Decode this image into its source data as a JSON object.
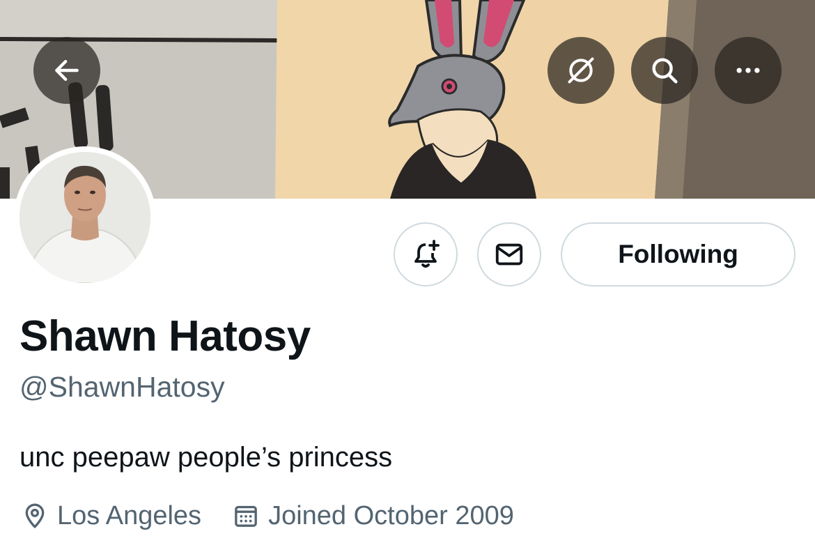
{
  "profile": {
    "display_name": "Shawn Hatosy",
    "handle": "@ShawnHatosy",
    "bio": "unc peepaw people’s princess",
    "location": "Los Angeles",
    "joined": "Joined October 2009"
  },
  "actions": {
    "following_label": "Following"
  },
  "icons": {
    "back": "arrow-left-icon",
    "grok": "grok-icon",
    "search": "search-icon",
    "more": "more-horizontal-icon",
    "notify": "bell-plus-icon",
    "message": "envelope-icon",
    "location": "location-pin-icon",
    "calendar": "calendar-icon"
  },
  "colors": {
    "text_primary": "#0f1419",
    "text_secondary": "#536471",
    "button_border": "#cfd9de",
    "overlay_button": "#2a2420"
  }
}
